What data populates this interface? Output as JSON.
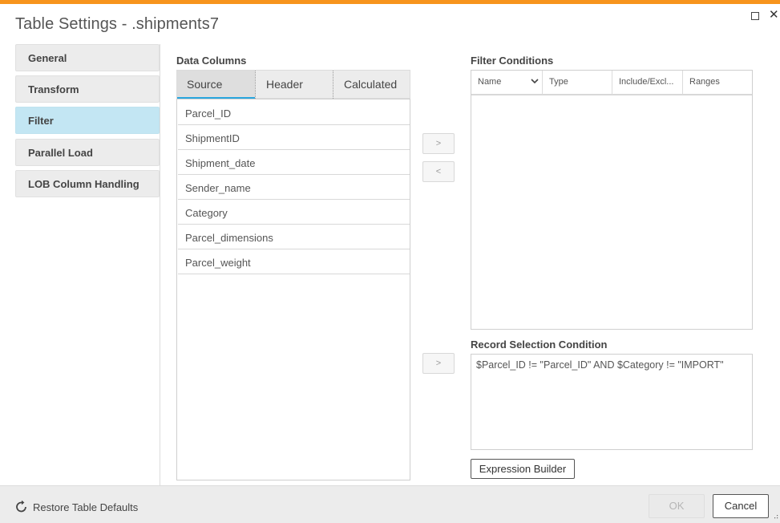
{
  "dialog": {
    "title": "Table Settings - .shipments7",
    "accent_color": "#f7941d"
  },
  "nav": {
    "items": [
      {
        "label": "General",
        "active": false
      },
      {
        "label": "Transform",
        "active": false
      },
      {
        "label": "Filter",
        "active": true
      },
      {
        "label": "Parallel Load",
        "active": false
      },
      {
        "label": "LOB Column Handling",
        "active": false
      }
    ]
  },
  "data_columns": {
    "label": "Data Columns",
    "tabs": [
      "Source",
      "Header",
      "Calculated"
    ],
    "active_tab": "Source",
    "rows": [
      "Parcel_ID",
      "ShipmentID",
      "Shipment_date",
      "Sender_name",
      "Category",
      "Parcel_dimensions",
      "Parcel_weight"
    ]
  },
  "transfer_buttons": {
    "add": ">",
    "remove": "<",
    "add_condition": ">"
  },
  "filter_conditions": {
    "label": "Filter Conditions",
    "columns": [
      "Name",
      "Type",
      "Include/Excl...",
      "Ranges"
    ]
  },
  "record_selection": {
    "label": "Record Selection Condition",
    "value": "$Parcel_ID != \"Parcel_ID\" AND $Category != \"IMPORT\"",
    "expression_builder_label": "Expression Builder"
  },
  "footer": {
    "restore_label": "Restore Table Defaults",
    "ok_label": "OK",
    "cancel_label": "Cancel"
  },
  "icons": {
    "maximize": "maximize-icon",
    "close": "close-icon",
    "restore": "restore-icon",
    "sort": "chevron-down-icon"
  },
  "colors": {
    "active_nav": "#c3e6f3",
    "tab_underline": "#2aa6de"
  }
}
